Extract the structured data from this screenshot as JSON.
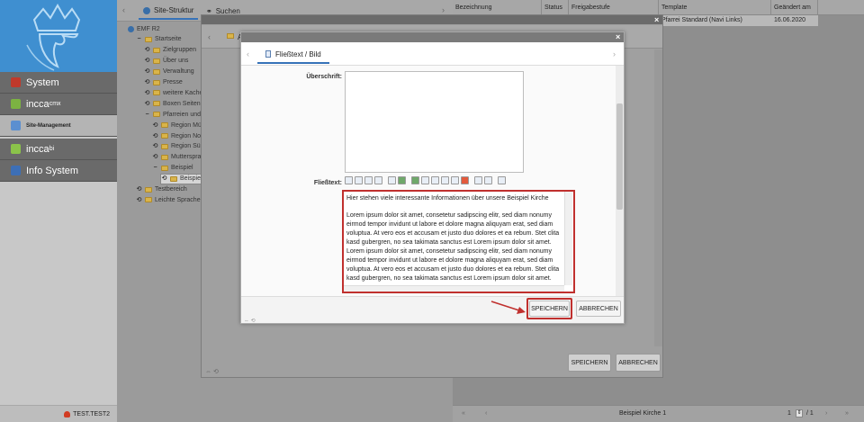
{
  "sidebar": {
    "nav": [
      {
        "label": "System",
        "sup": ""
      },
      {
        "label": "incca",
        "sup": "cmx"
      },
      {
        "label": "Site-Management",
        "sup": ""
      },
      {
        "label": "incca",
        "sup": "bi"
      },
      {
        "label": "Info System",
        "sup": ""
      }
    ],
    "user": "TEST.TEST2"
  },
  "tree": {
    "tabs": [
      "Site-Struktur",
      "Suchen"
    ],
    "nodes": [
      {
        "label": "EMF R2",
        "exp": "",
        "depth": 0
      },
      {
        "label": "Startseite",
        "exp": "−",
        "depth": 1
      },
      {
        "label": "Zielgruppen",
        "exp": "⟲",
        "depth": 2
      },
      {
        "label": "Über uns",
        "exp": "⟲",
        "depth": 2
      },
      {
        "label": "Verwaltung",
        "exp": "⟲",
        "depth": 2
      },
      {
        "label": "Presse",
        "exp": "⟲",
        "depth": 2
      },
      {
        "label": "weitere Kachein",
        "exp": "⟲",
        "depth": 2
      },
      {
        "label": "Boxen Seitenei",
        "exp": "⟲",
        "depth": 2
      },
      {
        "label": "Pfarreien und P",
        "exp": "−",
        "depth": 2
      },
      {
        "label": "Region Münc",
        "exp": "⟲",
        "depth": 3
      },
      {
        "label": "Region Nord",
        "exp": "⟲",
        "depth": 3
      },
      {
        "label": "Region Süd",
        "exp": "⟲",
        "depth": 3
      },
      {
        "label": "Muttersprach",
        "exp": "⟲",
        "depth": 3
      },
      {
        "label": "Beispiel",
        "exp": "−",
        "depth": 3
      },
      {
        "label": "Beispiel Ki",
        "exp": "⟲",
        "depth": 4,
        "selected": true
      },
      {
        "label": "Testbereich",
        "exp": "⟲",
        "depth": 1
      },
      {
        "label": "Leichte Sprache",
        "exp": "⟲",
        "depth": 1
      }
    ]
  },
  "grid": {
    "columns": [
      "Bezeichnung",
      "Status",
      "Freigabestufe",
      "Template",
      "Geändert am"
    ],
    "row": {
      "template": "Pfarrei Standard (Navi Links)",
      "date": "16.06.2020"
    },
    "footer": {
      "page_title": "Beispiel Kirche 1",
      "page": "1",
      "of": "/ 1"
    }
  },
  "outer_dialog": {
    "tab_label": "A",
    "save": "SPEICHERN",
    "cancel": "ABBRECHEN"
  },
  "inner_dialog": {
    "tab": "Fließtext / Bild",
    "heading_label": "Überschrift:",
    "body_label": "Fließtext:",
    "body_intro": "Hier stehen viele interessante Informationen über unsere Beispiel Kirche",
    "body_lorem": "Lorem ipsum dolor sit amet, consetetur sadipscing elitr, sed diam nonumy eirmod tempor invidunt ut labore et dolore magna aliquyam erat, sed diam voluptua. At vero eos et accusam et justo duo dolores et ea rebum. Stet clita kasd gubergren, no sea takimata sanctus est Lorem ipsum dolor sit amet. Lorem ipsum dolor sit amet, consetetur sadipscing elitr, sed diam nonumy eirmod tempor invidunt ut labore et dolore magna aliquyam erat, sed diam voluptua. At vero eos et accusam et justo duo dolores et ea rebum. Stet clita kasd gubergren, no sea takimata sanctus est Lorem ipsum dolor sit amet.",
    "save": "SPEICHERN",
    "cancel": "ABBRECHEN"
  },
  "colors": {
    "accent": "#3672b8",
    "highlight": "#c0302e",
    "logo_bg": "#3f8fd0"
  }
}
